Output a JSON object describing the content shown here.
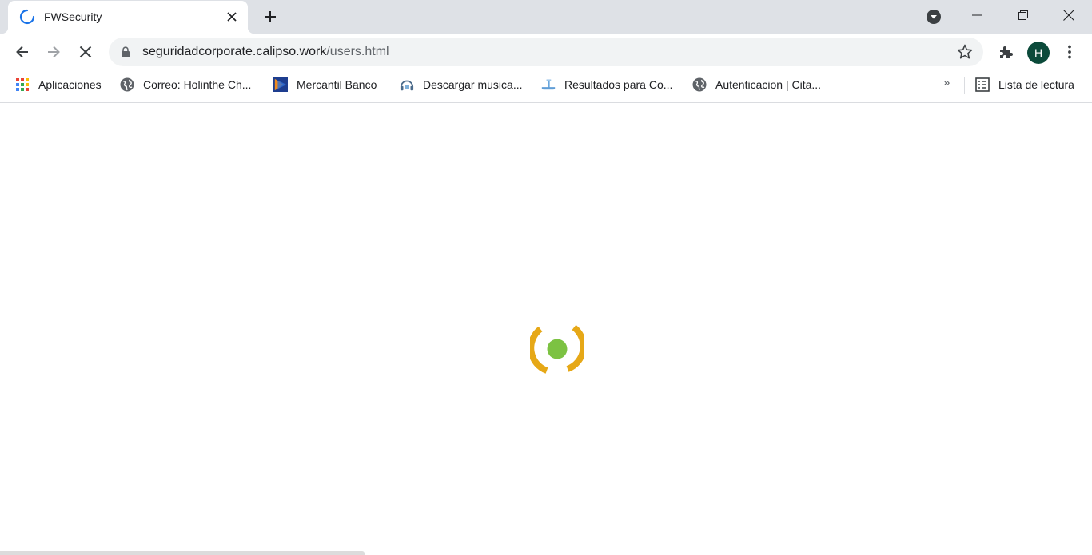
{
  "tab": {
    "title": "FWSecurity",
    "spinner_color": "#1a73e8"
  },
  "toolbar": {
    "url_host": "seguridadcorporate.calipso.work",
    "url_path": "/users.html",
    "avatar_initial": "H",
    "avatar_color": "#0b4a3a"
  },
  "bookmarks": {
    "items": [
      {
        "label": "Aplicaciones",
        "icon": "apps-grid-icon"
      },
      {
        "label": "Correo: Holinthe Ch...",
        "icon": "globe-icon"
      },
      {
        "label": "Mercantil Banco",
        "icon": "mercantil-logo-icon"
      },
      {
        "label": "Descargar musica...",
        "icon": "music-site-icon"
      },
      {
        "label": "Resultados para Co...",
        "icon": "site-favicon-icon"
      },
      {
        "label": "Autenticacion | Cita...",
        "icon": "globe-icon"
      }
    ],
    "more": "»",
    "reading_list": "Lista de lectura"
  },
  "page": {
    "loader_colors": {
      "arcs": "#e6a817",
      "dot": "#7cc242"
    }
  }
}
